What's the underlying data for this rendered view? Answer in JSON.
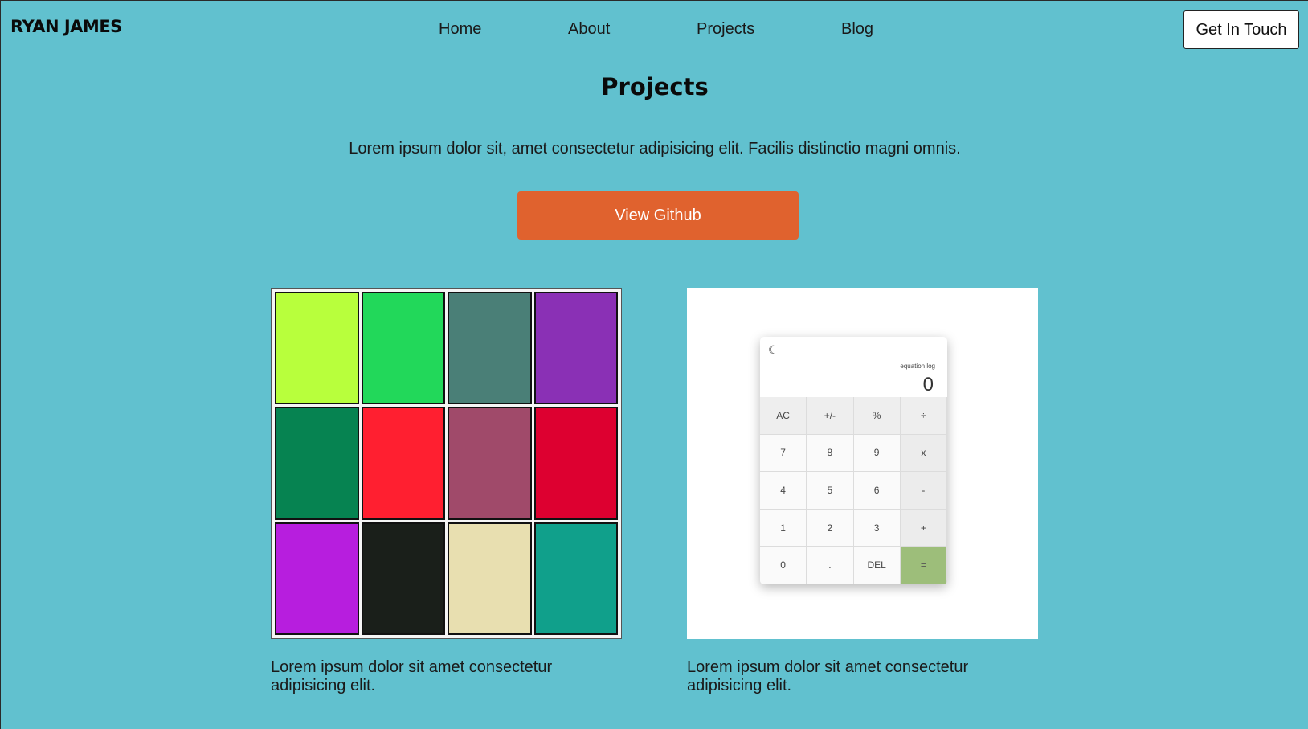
{
  "nav": {
    "logo": "RYAN JAMES",
    "links": [
      "Home",
      "About",
      "Projects",
      "Blog"
    ],
    "cta": "Get In Touch"
  },
  "hero": {
    "title": "Projects",
    "subtitle": "Lorem ipsum dolor sit, amet consectetur adipisicing elit. Facilis distinctio magni omnis.",
    "button": "View Github"
  },
  "projects": [
    {
      "image": "color-grid-preview",
      "swatches": [
        "#b8ff3c",
        "#22d85a",
        "#4a7f77",
        "#8a30b5",
        "#068351",
        "#ff1f30",
        "#a04a6a",
        "#dd0030",
        "#b71ede",
        "#1a1f1a",
        "#e8dfb0",
        "#10a08b"
      ],
      "caption": "Lorem ipsum dolor sit amet consectetur adipisicing elit."
    },
    {
      "image": "calculator-preview",
      "calculator": {
        "log_label": "equation log",
        "display": "0",
        "keys": [
          "AC",
          "+/-",
          "%",
          "÷",
          "7",
          "8",
          "9",
          "x",
          "4",
          "5",
          "6",
          "-",
          "1",
          "2",
          "3",
          "+",
          "0",
          ".",
          "DEL",
          "="
        ]
      },
      "caption": "Lorem ipsum dolor sit amet consectetur adipisicing elit."
    }
  ]
}
